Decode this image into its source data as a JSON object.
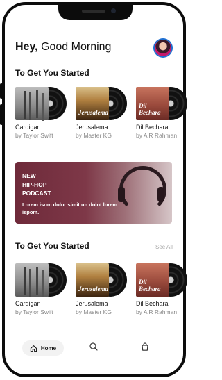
{
  "header": {
    "greeting_bold": "Hey,",
    "greeting_rest": "Good Morning"
  },
  "section1": {
    "title": "To Get You Started",
    "items": [
      {
        "title": "Cardigan",
        "subtitle": "by Taylor Swift",
        "cover_text": ""
      },
      {
        "title": "Jerusalema",
        "subtitle": "by Master KG",
        "cover_text": "Jerusalema"
      },
      {
        "title": "Dil Bechara",
        "subtitle": "by A R Rahman",
        "cover_text": "Dil Bechara"
      }
    ]
  },
  "banner": {
    "title": "NEW\nHIP-HOP\nPODCAST",
    "description": "Lorem isom dolor simit un dolot lorem ispom."
  },
  "section2": {
    "title": "To Get You Started",
    "see_all": "See All",
    "items": [
      {
        "title": "Cardigan",
        "subtitle": "by Taylor Swift",
        "cover_text": ""
      },
      {
        "title": "Jerusalema",
        "subtitle": "by Master KG",
        "cover_text": "Jerusalema"
      },
      {
        "title": "Dil Bechara",
        "subtitle": "by A R Rahman",
        "cover_text": "Dil Bechara"
      }
    ]
  },
  "nav": {
    "home_label": "Home",
    "icons": [
      "home-icon",
      "search-icon",
      "bag-icon"
    ]
  },
  "colors": {
    "frame": "#0c0c0c",
    "banner": "#6e2a3a",
    "avatar_ring": "#1f6fd1"
  }
}
